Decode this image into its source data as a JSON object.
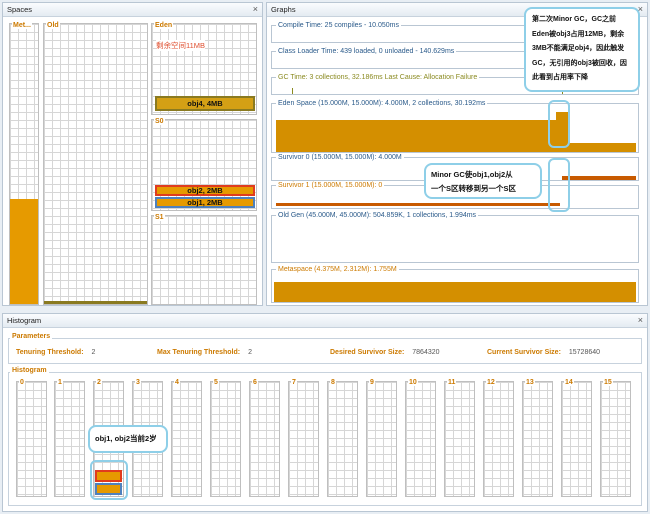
{
  "spaces_panel": {
    "title": "Spaces",
    "close": "×"
  },
  "spaces": {
    "metaspace": {
      "label": "Met..."
    },
    "old": {
      "label": "Old"
    },
    "eden": {
      "label": "Eden",
      "note": "剩余空间11MB",
      "obj4": "obj4, 4MB"
    },
    "s0": {
      "label": "S0",
      "obj2": "obj2, 2MB",
      "obj1": "obj1, 2MB"
    },
    "s1": {
      "label": "S1"
    }
  },
  "graphs_panel": {
    "title": "Graphs",
    "close": "×",
    "compile": "Compile Time: 25 compiles - 10.050ms",
    "classloader": "Class Loader Time: 439 loaded, 0 unloaded - 140.629ms",
    "gc": "GC Time: 3 collections, 32.186ms Last Cause: Allocation Failure",
    "eden": "Eden Space (15.000M, 15.000M): 4.000M, 2 collections, 30.192ms",
    "s0": "Survivor 0 (15.000M, 15.000M): 4.000M",
    "s1": "Survivor 1 (15.000M, 15.000M): 0",
    "old": "Old Gen (45.000M, 45.000M): 504.859K, 1 collections, 1.994ms",
    "meta": "Metaspace (4.375M, 2.312M): 1.755M"
  },
  "callouts": {
    "minor_gc_2": [
      "第二次Minor GC，GC之前",
      "Eden被obj3占用12MB，剩余",
      "3MB不能满足obj4，因此触发",
      "GC，无引用的obj3被回收，因",
      "此看到占用率下降"
    ],
    "minor_gc_move": [
      "Minor GC使obj1,obj2从",
      "一个S区转移到另一个S区"
    ],
    "age": [
      "obj1, obj2当前2岁"
    ]
  },
  "histogram_panel": {
    "title": "Histogram",
    "close": "×",
    "parameters_title": "Parameters",
    "histogram_title": "Histogram",
    "tenuring_threshold_label": "Tenuring Threshold:",
    "tenuring_threshold": "2",
    "max_tenuring_label": "Max Tenuring Threshold:",
    "max_tenuring": "2",
    "desired_survivor_label": "Desired Survivor Size:",
    "desired_survivor": "7864320",
    "current_survivor_label": "Current Survivor Size:",
    "current_survivor": "15728640",
    "buckets": [
      "0",
      "1",
      "2",
      "3",
      "4",
      "5",
      "6",
      "7",
      "8",
      "9",
      "10",
      "11",
      "12",
      "13",
      "14",
      "15"
    ]
  },
  "colors": {
    "fill": "#e69a00",
    "accent_label": "#cc7a00",
    "callout_border": "#8ecfe8",
    "obj_red": "#e03c1e",
    "obj_blue": "#4f81bd"
  }
}
